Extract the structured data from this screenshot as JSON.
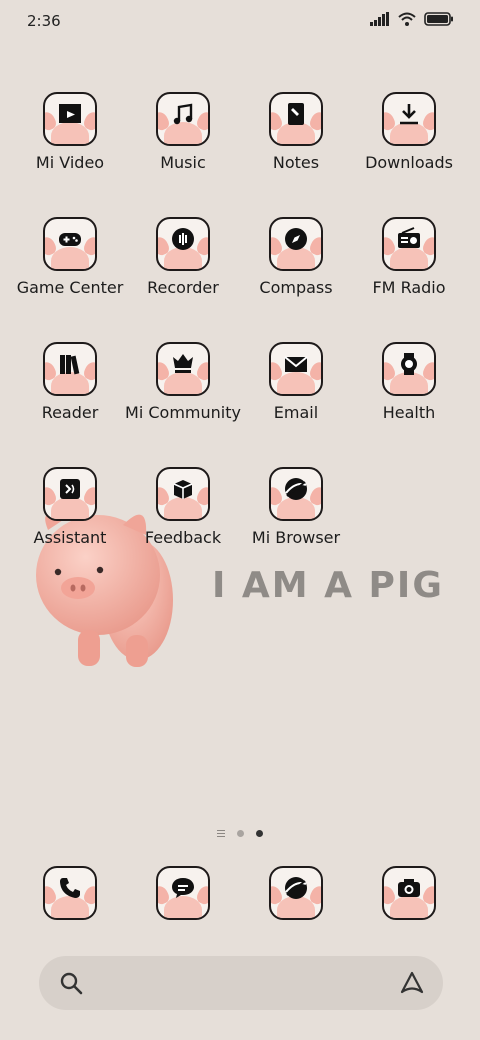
{
  "status_bar": {
    "time": "2:36",
    "icons": [
      "signal-icon",
      "wifi-icon",
      "battery-icon"
    ]
  },
  "apps": [
    {
      "label": "Mi Video",
      "icon": "video-icon"
    },
    {
      "label": "Music",
      "icon": "music-icon"
    },
    {
      "label": "Notes",
      "icon": "notes-icon"
    },
    {
      "label": "Downloads",
      "icon": "download-icon"
    },
    {
      "label": "Game Center",
      "icon": "gamepad-icon"
    },
    {
      "label": "Recorder",
      "icon": "recorder-icon"
    },
    {
      "label": "Compass",
      "icon": "compass-icon"
    },
    {
      "label": "FM Radio",
      "icon": "radio-icon"
    },
    {
      "label": "Reader",
      "icon": "books-icon"
    },
    {
      "label": "Mi Community",
      "icon": "community-icon"
    },
    {
      "label": "Email",
      "icon": "mail-icon"
    },
    {
      "label": "Health",
      "icon": "watch-icon"
    },
    {
      "label": "Assistant",
      "icon": "assistant-icon"
    },
    {
      "label": "Feedback",
      "icon": "feedback-icon"
    },
    {
      "label": "Mi Browser",
      "icon": "browser-icon"
    }
  ],
  "wallpaper": {
    "text": "I AM A PIG"
  },
  "page_indicator": {
    "pages": 2,
    "active": 2
  },
  "dock": [
    {
      "icon": "phone-icon"
    },
    {
      "icon": "messages-icon"
    },
    {
      "icon": "browser-icon"
    },
    {
      "icon": "camera-icon"
    }
  ],
  "search": {
    "left_icon": "search-icon",
    "right_icon": "assistant-a-icon"
  },
  "colors": {
    "background": "#e6dfd9",
    "icon_border": "#1e1a1a",
    "pig_pink": "#f6c2b8",
    "text_gray": "#8f8b87"
  }
}
